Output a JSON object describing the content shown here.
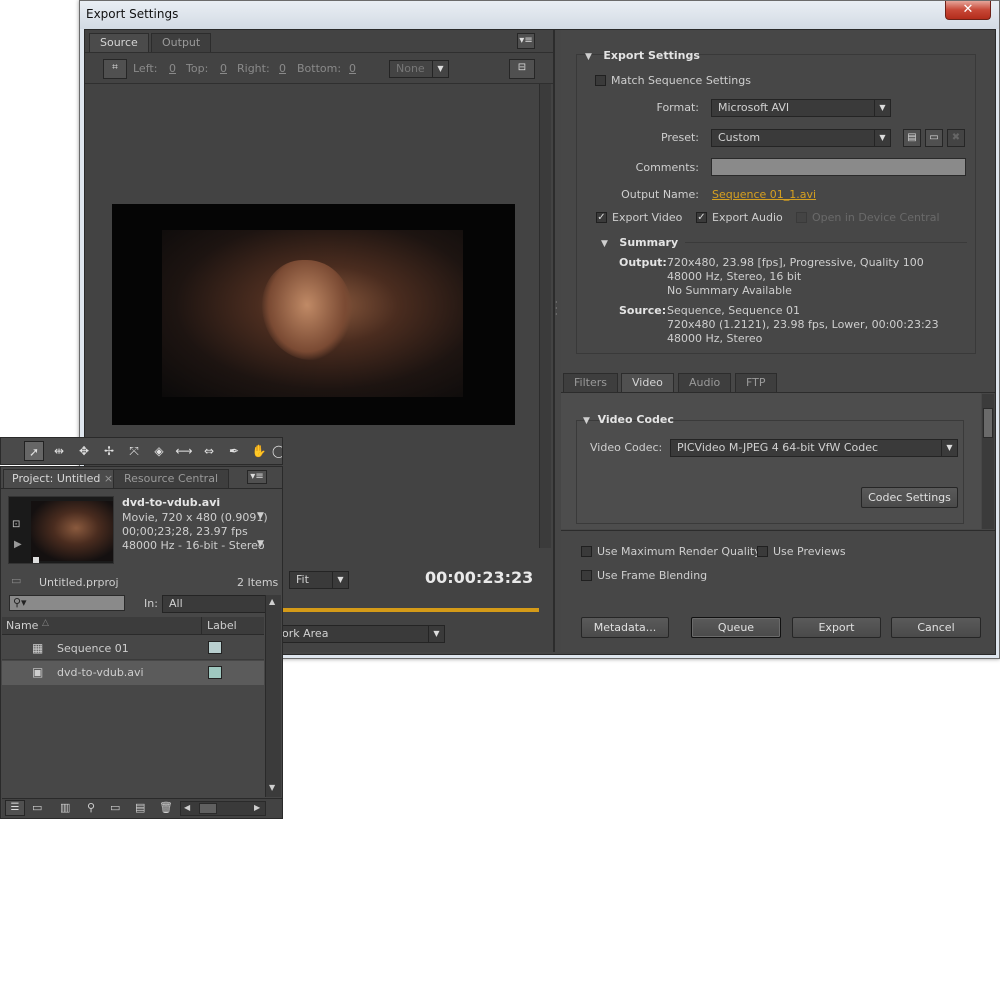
{
  "window": {
    "title": "Export Settings",
    "close": "✕"
  },
  "left": {
    "tabs": [
      "Source",
      "Output"
    ],
    "crop": {
      "left_label": "Left:",
      "left": "0",
      "top_label": "Top:",
      "top": "0",
      "right_label": "Right:",
      "right": "0",
      "bottom_label": "Bottom:",
      "bottom": "0",
      "preset": "None"
    },
    "fit": "Fit",
    "timecode": "00:00:23:23",
    "range": "ork Area"
  },
  "export_settings": {
    "heading": "Export Settings",
    "match_sequence": "Match Sequence Settings",
    "format_label": "Format:",
    "format": "Microsoft AVI",
    "preset_label": "Preset:",
    "preset": "Custom",
    "comments_label": "Comments:",
    "comments": "",
    "output_name_label": "Output Name:",
    "output_name": "Sequence 01_1.avi",
    "export_video": "Export Video",
    "export_audio": "Export Audio",
    "device_central": "Open in Device Central",
    "summary_heading": "Summary",
    "output_label": "Output:",
    "output_lines": [
      "720x480, 23.98 [fps], Progressive, Quality 100",
      "48000 Hz, Stereo, 16 bit",
      "No Summary Available"
    ],
    "source_label": "Source:",
    "source_lines": [
      "Sequence, Sequence 01",
      "720x480 (1.2121), 23.98 fps, Lower, 00:00:23:23",
      "48000 Hz, Stereo"
    ]
  },
  "lower_tabs": [
    "Filters",
    "Video",
    "Audio",
    "FTP"
  ],
  "video_codec": {
    "heading": "Video Codec",
    "label": "Video Codec:",
    "value": "PICVideo M-JPEG 4 64-bit VfW Codec",
    "settings": "Codec Settings"
  },
  "options": {
    "max_quality": "Use Maximum Render Quality",
    "previews": "Use Previews",
    "blending": "Use Frame Blending"
  },
  "buttons": {
    "metadata": "Metadata...",
    "queue": "Queue",
    "export": "Export",
    "cancel": "Cancel"
  },
  "project": {
    "tabs": [
      "Project: Untitled",
      "Resource Central"
    ],
    "clip_name": "dvd-to-vdub.avi",
    "clip_info": [
      "Movie, 720 x 480 (0.9091)",
      "00;00;23;28, 23.97 fps",
      "48000 Hz - 16-bit - Stereo"
    ],
    "file": "Untitled.prproj",
    "count": "2 Items",
    "in_label": "In:",
    "in_value": "All",
    "columns": [
      "Name",
      "Label"
    ],
    "items": [
      {
        "name": "Sequence 01",
        "color": "#b9cfcf"
      },
      {
        "name": "dvd-to-vdub.avi",
        "color": "#9fc8c0"
      }
    ]
  }
}
